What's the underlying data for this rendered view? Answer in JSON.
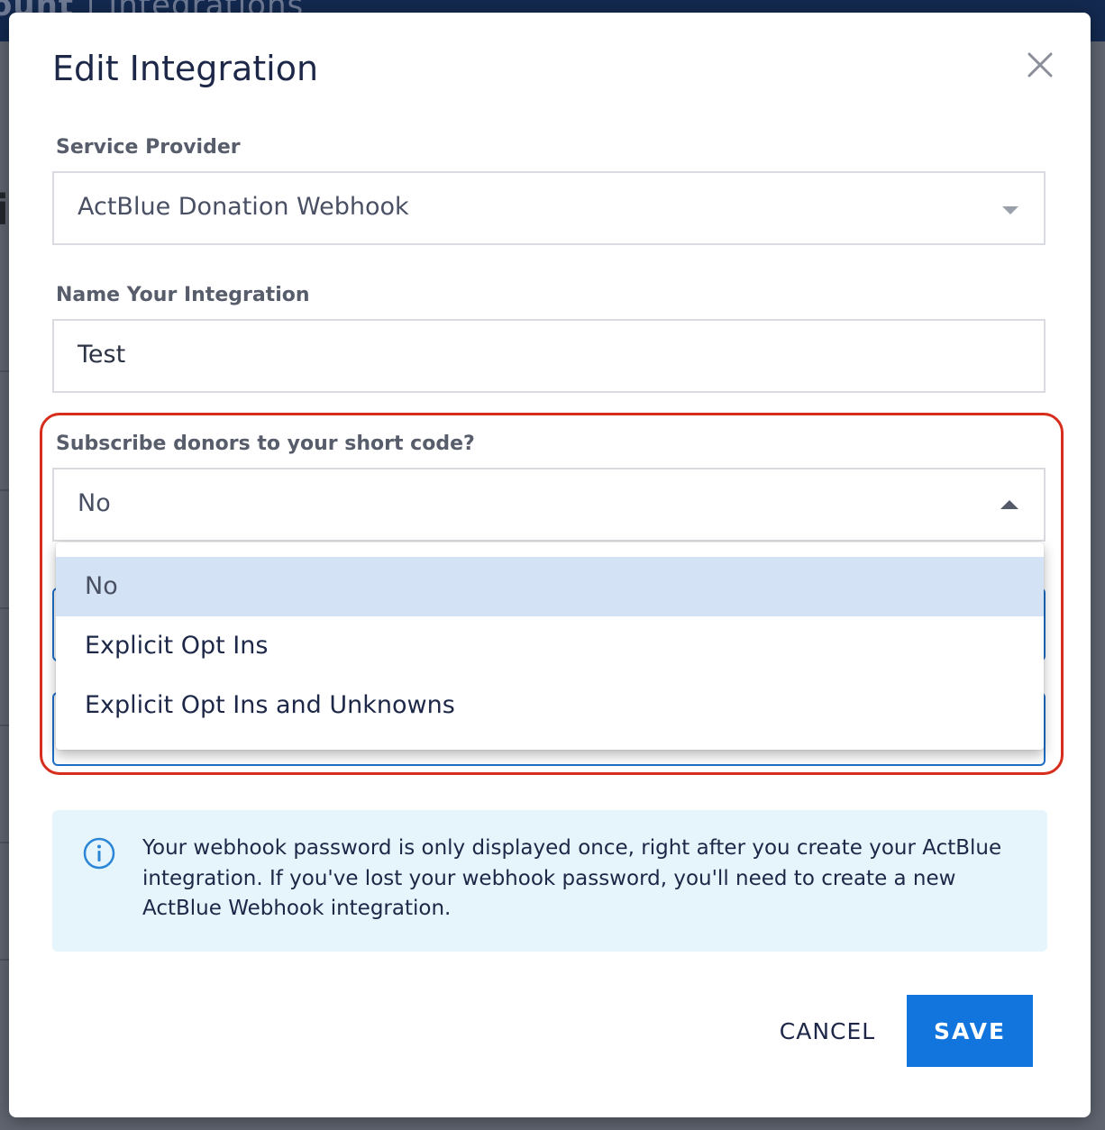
{
  "background": {
    "breadcrumb_bold": "ount",
    "breadcrumb_sep": "|",
    "breadcrumb_light": "Integrations",
    "partial_char": "i"
  },
  "modal": {
    "title": "Edit Integration",
    "close_icon": "close-icon"
  },
  "fields": {
    "service_provider": {
      "label": "Service Provider",
      "value": "ActBlue Donation Webhook"
    },
    "integration_name": {
      "label": "Name Your Integration",
      "value": "Test"
    },
    "subscribe": {
      "label": "Subscribe donors to your short code?",
      "value": "No",
      "options": [
        "No",
        "Explicit Opt Ins",
        "Explicit Opt Ins and Unknowns"
      ],
      "selected_index": 0
    }
  },
  "info": {
    "icon": "info-icon",
    "text": "Your webhook password is only displayed once, right after you create your ActBlue integration. If you've lost your webhook password, you'll need to create a new ActBlue Webhook integration."
  },
  "actions": {
    "cancel_label": "CANCEL",
    "save_label": "SAVE"
  },
  "colors": {
    "primary": "#1175dd",
    "highlight": "#d62d1c",
    "selected_option": "#d4e2f6",
    "info_bg": "#e6f4fb",
    "text_dark": "#1d2747"
  }
}
